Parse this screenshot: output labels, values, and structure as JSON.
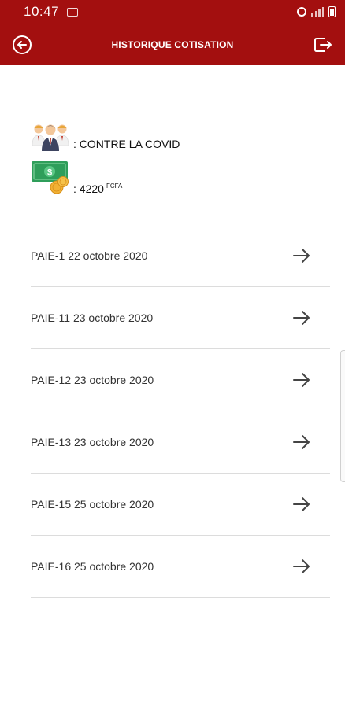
{
  "status_bar": {
    "time": "10:47"
  },
  "header": {
    "title": "HISTORIQUE COTISATION",
    "background_color": "#a30f0f",
    "back_icon": "back-arrow-circle-icon",
    "logout_icon": "logout-icon"
  },
  "summary": {
    "campaign_text": ": CONTRE LA COVID",
    "amount_prefix": ": 4220",
    "currency": "FCFA",
    "campaign_icon": "people-group-icon",
    "amount_icon": "money-coins-icon"
  },
  "payments": [
    {
      "label": "PAIE-1 22 octobre 2020"
    },
    {
      "label": "PAIE-11 23 octobre 2020"
    },
    {
      "label": "PAIE-12 23 octobre 2020"
    },
    {
      "label": "PAIE-13 23 octobre 2020"
    },
    {
      "label": "PAIE-15 25 octobre 2020"
    },
    {
      "label": "PAIE-16 25 octobre 2020"
    }
  ]
}
